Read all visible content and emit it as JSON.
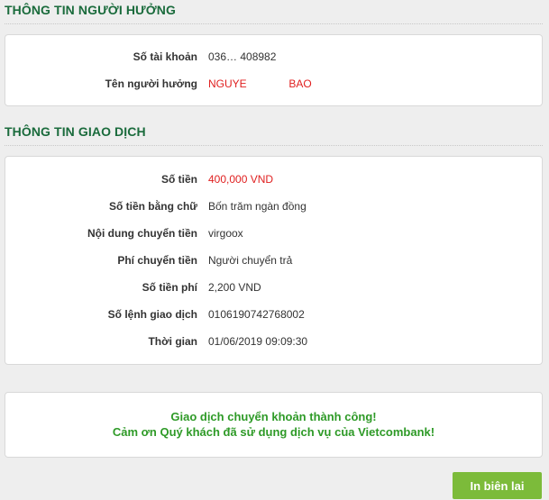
{
  "beneficiary": {
    "title": "THÔNG TIN NGƯỜI HƯỞNG",
    "account_label": "Số tài khoản",
    "account_value": "036…   408982",
    "name_label": "Tên người hưởng",
    "name_value": "NGUYE              BAO"
  },
  "transaction": {
    "title": "THÔNG TIN GIAO DỊCH",
    "rows": [
      {
        "label": "Số tiền",
        "value": "400,000 VND"
      },
      {
        "label": "Số tiền bằng chữ",
        "value": "Bốn trăm ngàn đồng"
      },
      {
        "label": "Nội dung chuyển tiền",
        "value": "virgoox"
      },
      {
        "label": "Phí chuyển tiền",
        "value": "Người chuyển trả"
      },
      {
        "label": "Số tiền phí",
        "value": "2,200 VND"
      },
      {
        "label": "Số lệnh giao dịch",
        "value": "0106190742768002"
      },
      {
        "label": "Thời gian",
        "value": "01/06/2019 09:09:30"
      }
    ]
  },
  "notice": {
    "line1": "Giao dịch chuyển khoản thành công!",
    "line2": "Cảm ơn Quý khách đã sử dụng dịch vụ của Vietcombank!"
  },
  "actions": {
    "print_label": "In biên lai"
  },
  "colors": {
    "title_green": "#1a6b3c",
    "success_green": "#2e9a27",
    "amount_red": "#e02020",
    "button_green": "#7cbb3a"
  }
}
